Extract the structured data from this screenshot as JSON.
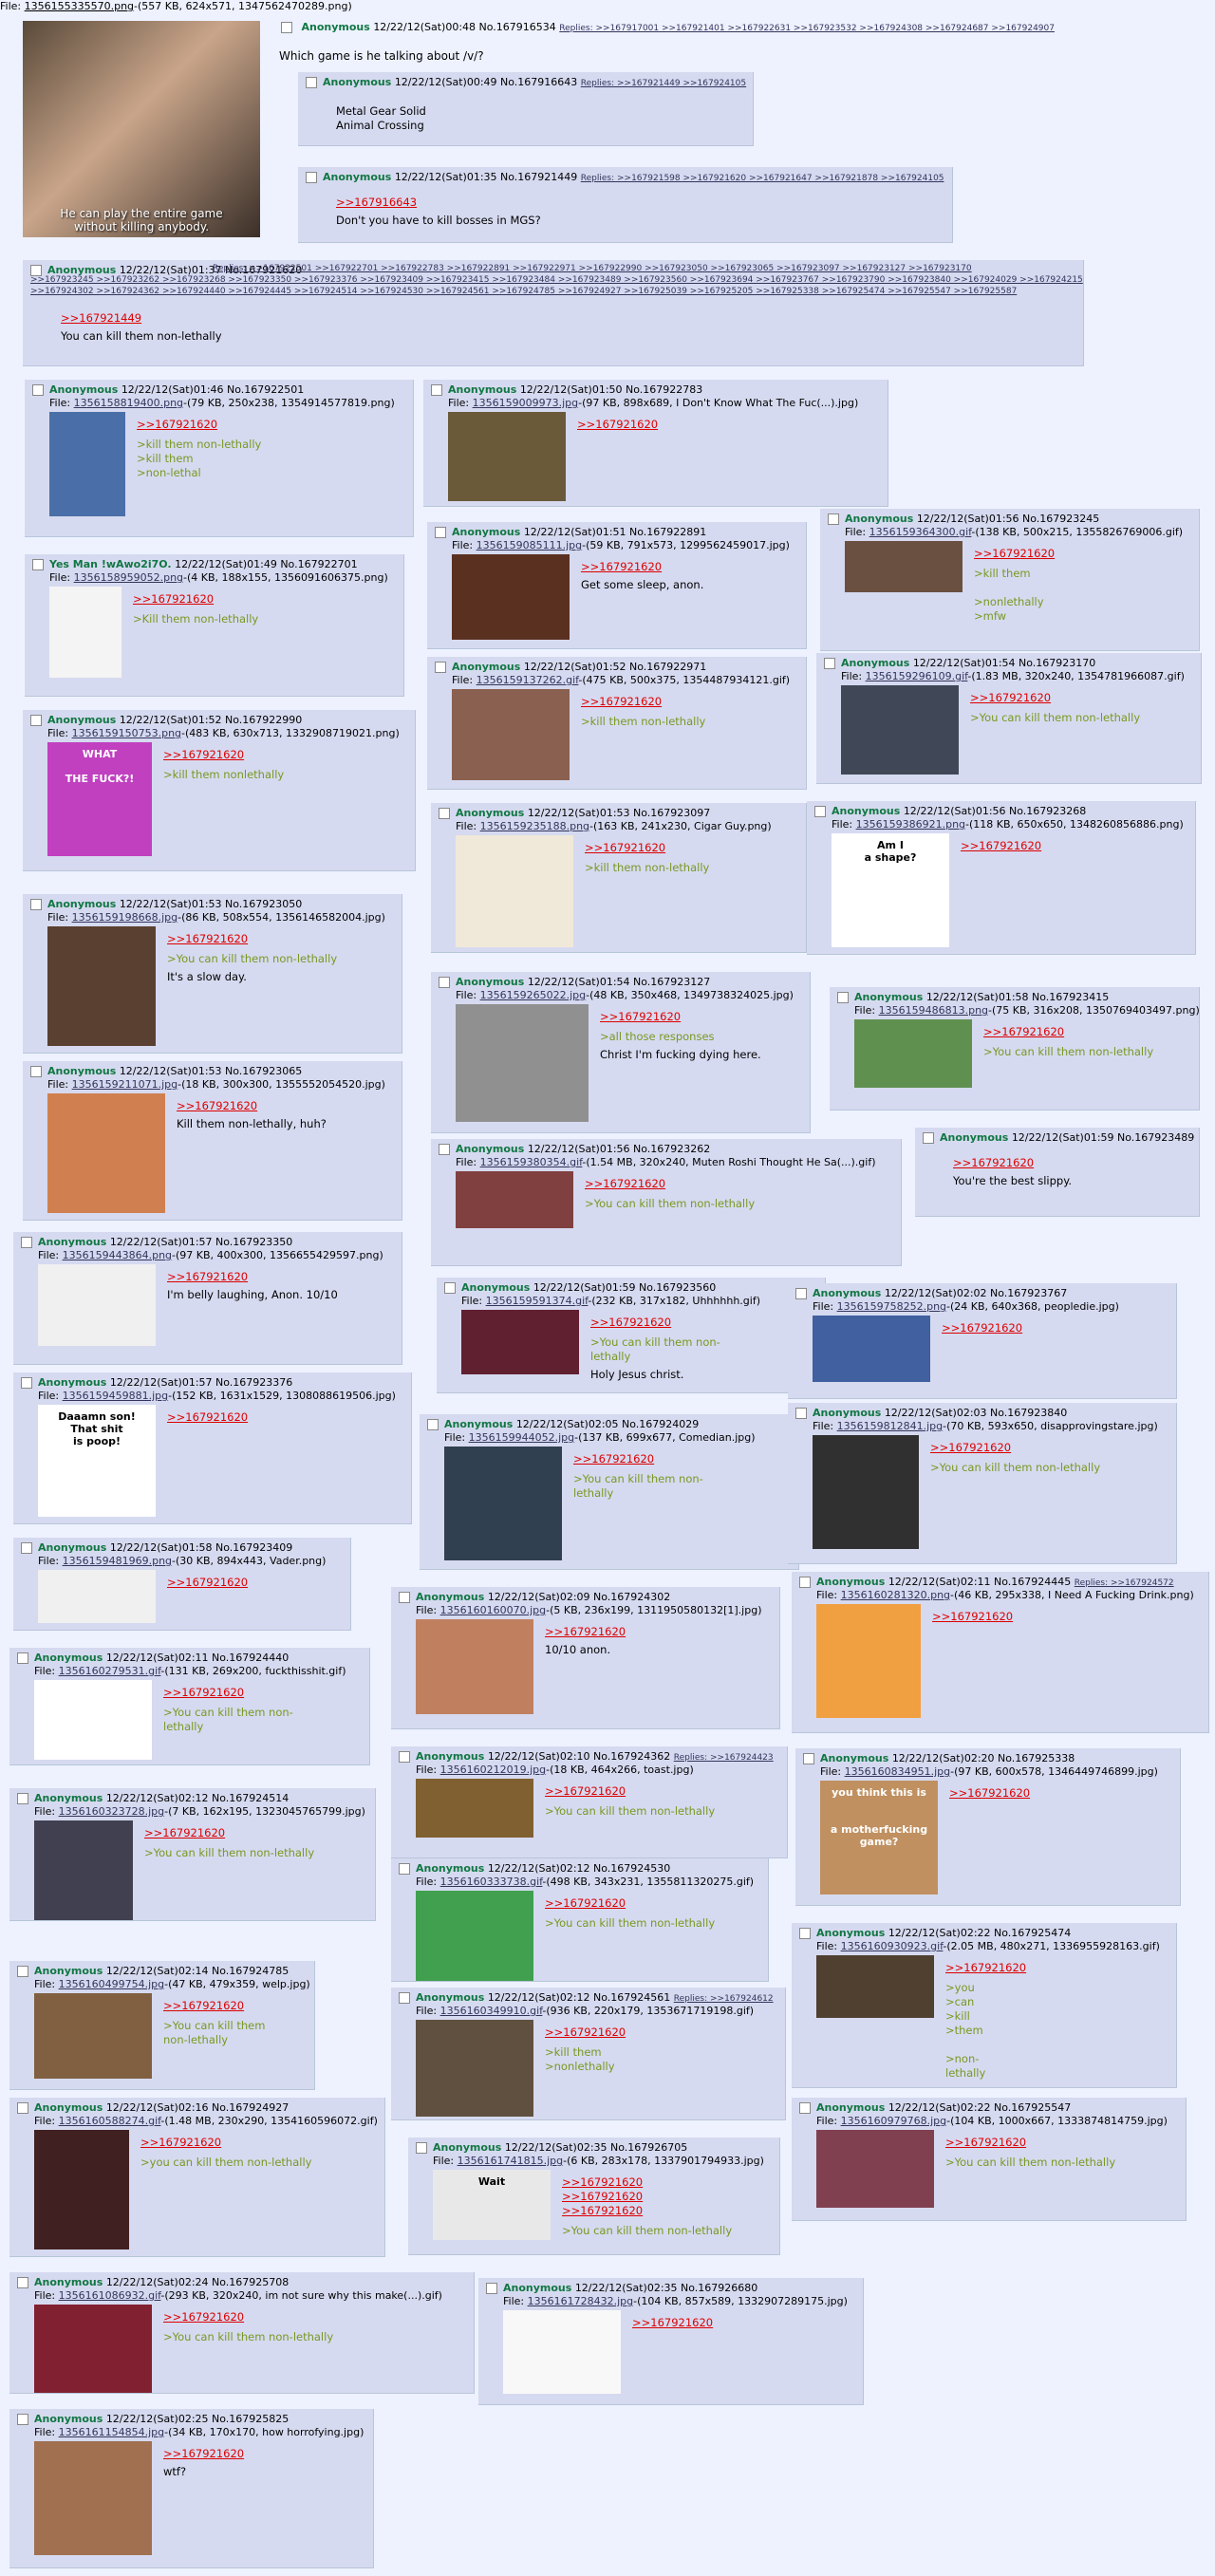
{
  "op": {
    "file_label": "File:",
    "file_link": "1356155335570.png",
    "file_meta": "-(557 KB, 624x571, 1347562470289.png)",
    "caption": "He can play the entire game\nwithout killing anybody.",
    "name": "Anonymous",
    "date": "12/22/12(Sat)00:48 No.167916534",
    "replies": "Replies: >>167917001 >>167921401 >>167922631 >>167923532 >>167924308 >>167924687 >>167924907",
    "comment": "Which game is he talking about /v/?"
  },
  "posts": [
    {
      "id": "p167916643",
      "name": "Anonymous",
      "date": "12/22/12(Sat)00:49 No.167916643",
      "replies": "Replies: >>167921449 >>167924105",
      "body": "Metal Gear Solid\nAnimal Crossing"
    },
    {
      "id": "p167921449",
      "name": "Anonymous",
      "date": "12/22/12(Sat)01:35 No.167921449",
      "replies": "Replies: >>167921598 >>167921620 >>167921647 >>167921878 >>167924105",
      "quote": ">>167916643",
      "body": "Don't you have to kill bosses in MGS?"
    },
    {
      "id": "p167921620",
      "name": "Anonymous",
      "date": "12/22/12(Sat)01:37 No.167921620",
      "replies1": "Replies: >>167922501 >>167922701 >>167922783 >>167922891 >>167922971 >>167922990 >>167923050 >>167923065 >>167923097 >>167923127 >>167923170",
      "replies2": ">>167923245 >>167923262 >>167923268 >>167923350 >>167923376 >>167923409 >>167923415 >>167923484 >>167923489 >>167923560 >>167923694 >>167923767 >>167923790 >>167923840 >>167924029 >>167924215",
      "replies3": ">>167924302 >>167924362 >>167924440 >>167924445 >>167924514 >>167924530 >>167924561 >>167924785 >>167924927 >>167925039 >>167925205 >>167925338 >>167925474 >>167925547 >>167925587",
      "quote": ">>167921449",
      "body": "You can kill them non-lethally"
    },
    {
      "id": "p167922501",
      "name": "Anonymous",
      "date": "12/22/12(Sat)01:46 No.167922501",
      "flink": "1356158819400.png",
      "fmeta": "-(79 KB, 250x238, 1354914577819.png)",
      "quote": ">>167921620",
      "green": ">kill them non-lethally\n>kill them\n>non-lethal"
    },
    {
      "id": "p167922783",
      "name": "Anonymous",
      "date": "12/22/12(Sat)01:50 No.167922783",
      "flink": "1356159009973.jpg",
      "fmeta": "-(97 KB, 898x689, I Don't Know What The Fuc(...).jpg)",
      "quote": ">>167921620"
    },
    {
      "id": "p167922701",
      "name": "Yes Man !wAwo2i7O.",
      "date": "12/22/12(Sat)01:49 No.167922701",
      "flink": "1356158959052.png",
      "fmeta": "-(4 KB, 188x155, 1356091606375.png)",
      "quote": ">>167921620",
      "green": ">Kill them non-lethally"
    },
    {
      "id": "p167922891",
      "name": "Anonymous",
      "date": "12/22/12(Sat)01:51 No.167922891",
      "flink": "1356159085111.jpg",
      "fmeta": "-(59 KB, 791x573, 1299562459017.jpg)",
      "quote": ">>167921620",
      "body": "Get some sleep, anon."
    },
    {
      "id": "p167923245",
      "name": "Anonymous",
      "date": "12/22/12(Sat)01:56 No.167923245",
      "flink": "1356159364300.gif",
      "fmeta": "-(138 KB, 500x215, 1355826769006.gif)",
      "quote": ">>167921620",
      "green": ">kill them\n\n>nonlethally\n>mfw"
    },
    {
      "id": "p167922990",
      "name": "Anonymous",
      "date": "12/22/12(Sat)01:52 No.167922990",
      "flink": "1356159150753.png",
      "fmeta": "-(483 KB, 630x713, 1332908719021.png)",
      "quote": ">>167921620",
      "green": ">kill them nonlethally",
      "thumbtext": "WHAT\n\nTHE FUCK?!"
    },
    {
      "id": "p167922971",
      "name": "Anonymous",
      "date": "12/22/12(Sat)01:52 No.167922971",
      "flink": "1356159137262.gif",
      "fmeta": "-(475 KB, 500x375, 1354487934121.gif)",
      "quote": ">>167921620",
      "green": ">kill them non-lethally"
    },
    {
      "id": "p167923170",
      "name": "Anonymous",
      "date": "12/22/12(Sat)01:54 No.167923170",
      "flink": "1356159296109.gif",
      "fmeta": "-(1.83 MB, 320x240, 1354781966087.gif)",
      "quote": ">>167921620",
      "green": ">You can kill them non-lethally"
    },
    {
      "id": "p167923097",
      "name": "Anonymous",
      "date": "12/22/12(Sat)01:53 No.167923097",
      "flink": "1356159235188.png",
      "fmeta": "-(163 KB, 241x230, Cigar Guy.png)",
      "quote": ">>167921620",
      "green": ">kill them non-lethally"
    },
    {
      "id": "p167923268",
      "name": "Anonymous",
      "date": "12/22/12(Sat)01:56 No.167923268",
      "flink": "1356159386921.png",
      "fmeta": "-(118 KB, 650x650, 1348260856886.png)",
      "quote": ">>167921620",
      "thumbtext": "Am I\na shape?"
    },
    {
      "id": "p167923050",
      "name": "Anonymous",
      "date": "12/22/12(Sat)01:53 No.167923050",
      "flink": "1356159198668.jpg",
      "fmeta": "-(86 KB, 508x554, 1356146582004.jpg)",
      "quote": ">>167921620",
      "green": ">You can kill them non-lethally",
      "body": "It's a slow day."
    },
    {
      "id": "p167923127",
      "name": "Anonymous",
      "date": "12/22/12(Sat)01:54 No.167923127",
      "flink": "1356159265022.jpg",
      "fmeta": "-(48 KB, 350x468, 1349738324025.jpg)",
      "quote": ">>167921620",
      "green": ">all those responses",
      "body": "Christ I'm fucking dying here."
    },
    {
      "id": "p167923415",
      "name": "Anonymous",
      "date": "12/22/12(Sat)01:58 No.167923415",
      "flink": "1356159486813.png",
      "fmeta": "-(75 KB, 316x208, 1350769403497.png)",
      "quote": ">>167921620",
      "green": ">You can kill them non-lethally"
    },
    {
      "id": "p167923065",
      "name": "Anonymous",
      "date": "12/22/12(Sat)01:53 No.167923065",
      "flink": "1356159211071.jpg",
      "fmeta": "-(18 KB, 300x300, 1355552054520.jpg)",
      "quote": ">>167921620",
      "body": "Kill them non-lethally, huh?"
    },
    {
      "id": "p167923489",
      "name": "Anonymous",
      "date": "12/22/12(Sat)01:59 No.167923489",
      "quote": ">>167921620",
      "body": "You're the best slippy."
    },
    {
      "id": "p167923262",
      "name": "Anonymous",
      "date": "12/22/12(Sat)01:56 No.167923262",
      "flink": "1356159380354.gif",
      "fmeta": "-(1.54 MB, 320x240, Muten Roshi Thought He Sa(...).gif)",
      "quote": ">>167921620",
      "green": ">You can kill them non-lethally"
    },
    {
      "id": "p167923350",
      "name": "Anonymous",
      "date": "12/22/12(Sat)01:57 No.167923350",
      "flink": "1356159443864.png",
      "fmeta": "-(97 KB, 400x300, 1356655429597.png)",
      "quote": ">>167921620",
      "body": "I'm belly laughing, Anon. 10/10"
    },
    {
      "id": "p167923560",
      "name": "Anonymous",
      "date": "12/22/12(Sat)01:59 No.167923560",
      "flink": "1356159591374.gif",
      "fmeta": "-(232 KB, 317x182, Uhhhhhh.gif)",
      "quote": ">>167921620",
      "green": ">You can kill them non-\nlethally",
      "body": "Holy Jesus christ."
    },
    {
      "id": "p167923767",
      "name": "Anonymous",
      "date": "12/22/12(Sat)02:02 No.167923767",
      "flink": "1356159758252.png",
      "fmeta": "-(24 KB, 640x368, peopledie.jpg)",
      "quote": ">>167921620"
    },
    {
      "id": "p167923376",
      "name": "Anonymous",
      "date": "12/22/12(Sat)01:57 No.167923376",
      "flink": "1356159459881.jpg",
      "fmeta": "-(152 KB, 1631x1529, 1308088619506.jpg)",
      "quote": ">>167921620",
      "thumbtext": "Daaamn son!\nThat shit\nis poop!"
    },
    {
      "id": "p167924029",
      "name": "Anonymous",
      "date": "12/22/12(Sat)02:05 No.167924029",
      "flink": "1356159944052.jpg",
      "fmeta": "-(137 KB, 699x677, Comedian.jpg)",
      "quote": ">>167921620",
      "green": ">You can kill them non-\nlethally"
    },
    {
      "id": "p167923840",
      "name": "Anonymous",
      "date": "12/22/12(Sat)02:03 No.167923840",
      "flink": "1356159812841.jpg",
      "fmeta": "-(70 KB, 593x650, disapprovingstare.jpg)",
      "quote": ">>167921620",
      "green": ">You can kill them non-lethally"
    },
    {
      "id": "p167923409",
      "name": "Anonymous",
      "date": "12/22/12(Sat)01:58 No.167923409",
      "flink": "1356159481969.png",
      "fmeta": "-(30 KB, 894x443, Vader.png)",
      "quote": ">>167921620"
    },
    {
      "id": "p167924302",
      "name": "Anonymous",
      "date": "12/22/12(Sat)02:09 No.167924302",
      "flink": "1356160160070.jpg",
      "fmeta": "-(5 KB, 236x199, 1311950580132[1].jpg)",
      "quote": ">>167921620",
      "body": "10/10 anon."
    },
    {
      "id": "p167924445",
      "name": "Anonymous",
      "date": "12/22/12(Sat)02:11 No.167924445",
      "replies": "Replies: >>167924572",
      "flink": "1356160281320.png",
      "fmeta": "-(46 KB, 295x338, I Need A Fucking Drink.png)",
      "quote": ">>167921620"
    },
    {
      "id": "p167924440",
      "name": "Anonymous",
      "date": "12/22/12(Sat)02:11 No.167924440",
      "flink": "1356160279531.gif",
      "fmeta": "-(131 KB, 269x200, fuckthisshit.gif)",
      "quote": ">>167921620",
      "green": ">You can kill them non-\nlethally"
    },
    {
      "id": "p167924362",
      "name": "Anonymous",
      "date": "12/22/12(Sat)02:10 No.167924362",
      "replies": "Replies: >>167924423",
      "flink": "1356160212019.jpg",
      "fmeta": "-(18 KB, 464x266, toast.jpg)",
      "quote": ">>167921620",
      "green": ">You can kill them non-lethally"
    },
    {
      "id": "p167925338",
      "name": "Anonymous",
      "date": "12/22/12(Sat)02:20 No.167925338",
      "flink": "1356160834951.jpg",
      "fmeta": "-(97 KB, 600x578, 1346449746899.jpg)",
      "quote": ">>167921620",
      "thumbtext": "you think this is\n\n\na motherfucking game?"
    },
    {
      "id": "p167924514",
      "name": "Anonymous",
      "date": "12/22/12(Sat)02:12 No.167924514",
      "flink": "1356160323728.jpg",
      "fmeta": "-(7 KB, 162x195, 1323045765799.jpg)",
      "quote": ">>167921620",
      "green": ">You can kill them non-lethally"
    },
    {
      "id": "p167924530",
      "name": "Anonymous",
      "date": "12/22/12(Sat)02:12 No.167924530",
      "flink": "1356160333738.gif",
      "fmeta": "-(498 KB, 343x231, 1355811320275.gif)",
      "quote": ">>167921620",
      "green": ">You can kill them non-lethally"
    },
    {
      "id": "p167925474",
      "name": "Anonymous",
      "date": "12/22/12(Sat)02:22 No.167925474",
      "flink": "1356160930923.gif",
      "fmeta": "-(2.05 MB, 480x271, 1336955928163.gif)",
      "quote": ">>167921620",
      "green": ">you\n>can\n>kill\n>them\n\n>non-\nlethally"
    },
    {
      "id": "p167924785",
      "name": "Anonymous",
      "date": "12/22/12(Sat)02:14 No.167924785",
      "flink": "1356160499754.jpg",
      "fmeta": "-(47 KB, 479x359, welp.jpg)",
      "quote": ">>167921620",
      "green": ">You can kill them\nnon-lethally"
    },
    {
      "id": "p167924561",
      "name": "Anonymous",
      "date": "12/22/12(Sat)02:12 No.167924561",
      "replies": "Replies: >>167924612",
      "flink": "1356160349910.gif",
      "fmeta": "-(936 KB, 220x179, 1353671719198.gif)",
      "quote": ">>167921620",
      "green": ">kill them\n>nonlethally"
    },
    {
      "id": "p167924927",
      "name": "Anonymous",
      "date": "12/22/12(Sat)02:16 No.167924927",
      "flink": "1356160588274.gif",
      "fmeta": "-(1.48 MB, 230x290, 1354160596072.gif)",
      "quote": ">>167921620",
      "green": ">you can kill them non-lethally"
    },
    {
      "id": "p167925547",
      "name": "Anonymous",
      "date": "12/22/12(Sat)02:22 No.167925547",
      "flink": "1356160979768.jpg",
      "fmeta": "-(104 KB, 1000x667, 1333874814759.jpg)",
      "quote": ">>167921620",
      "green": ">You can kill them non-lethally"
    },
    {
      "id": "p167926705",
      "name": "Anonymous",
      "date": "12/22/12(Sat)02:35 No.167926705",
      "flink": "1356161741815.jpg",
      "fmeta": "-(6 KB, 283x178, 1337901794933.jpg)",
      "quote": ">>167921620\n>>167921620\n>>167921620",
      "green": ">You can kill them non-lethally",
      "thumbtext": "Wait"
    },
    {
      "id": "p167925708",
      "name": "Anonymous",
      "date": "12/22/12(Sat)02:24 No.167925708",
      "flink": "1356161086932.gif",
      "fmeta": "-(293 KB, 320x240, im not sure why this make(...).gif)",
      "quote": ">>167921620",
      "green": ">You can kill them non-lethally"
    },
    {
      "id": "p167926680",
      "name": "Anonymous",
      "date": "12/22/12(Sat)02:35 No.167926680",
      "flink": "1356161728432.jpg",
      "fmeta": "-(104 KB, 857x589, 1332907289175.jpg)",
      "quote": ">>167921620"
    },
    {
      "id": "p167925825",
      "name": "Anonymous",
      "date": "12/22/12(Sat)02:25 No.167925825",
      "flink": "1356161154854.jpg",
      "fmeta": "-(34 KB, 170x170, how horrofying.jpg)",
      "quote": ">>167921620",
      "body": "wtf?"
    }
  ],
  "labels": {
    "file": "File:"
  }
}
